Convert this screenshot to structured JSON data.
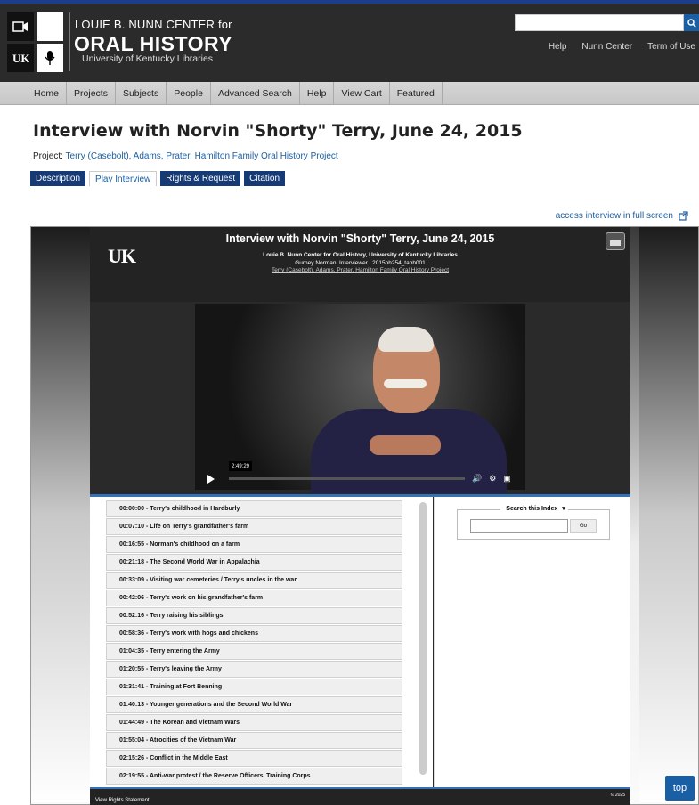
{
  "header": {
    "brand_top": "LOUIE B. NUNN CENTER for",
    "brand_main": "ORAL HISTORY",
    "brand_sub": "University of Kentucky Libraries",
    "search_placeholder": "",
    "links": [
      "Help",
      "Nunn Center",
      "Term of Use"
    ]
  },
  "nav": {
    "items": [
      "Home",
      "Projects",
      "Subjects",
      "People",
      "Advanced Search",
      "Help",
      "View Cart",
      "Featured"
    ]
  },
  "page": {
    "title": "Interview with Norvin \"Shorty\" Terry, June 24, 2015",
    "project_label": "Project:",
    "project_value": "Terry (Casebolt), Adams, Prater, Hamilton Family Oral History Project",
    "tabs": [
      "Description",
      "Play Interview",
      "Rights & Request",
      "Citation"
    ],
    "fullscreen": "access interview in full screen"
  },
  "player": {
    "logo": "UK",
    "title": "Interview with Norvin \"Shorty\" Terry, June 24, 2015",
    "sub1": "Louie B. Nunn Center for Oral History, University of Kentucky Libraries",
    "sub2": "Gurney Norman, Interviewer | 2015oh254_taph001",
    "sub3": "Terry (Casebolt), Adams, Prater, Hamilton Family Oral History Project",
    "time_bubble": "2:49:29"
  },
  "index": {
    "items": [
      "00:00:00 - Terry's childhood in Hardburly",
      "00:07:10 - Life on Terry's grandfather's farm",
      "00:16:55 - Norman's childhood on a farm",
      "00:21:18 - The Second World War in Appalachia",
      "00:33:09 - Visiting war cemeteries / Terry's uncles in the war",
      "00:42:06 - Terry's work on his grandfather's farm",
      "00:52:16 - Terry raising his siblings",
      "00:58:36 - Terry's work with hogs and chickens",
      "01:04:35 - Terry entering the Army",
      "01:20:55 - Terry's leaving the Army",
      "01:31:41 - Training at Fort Benning",
      "01:40:13 - Younger generations and the Second World War",
      "01:44:49 - The Korean and Vietnam Wars",
      "01:55:04 - Atrocities of the Vietnam War",
      "02:15:26 - Conflict in the Middle East",
      "02:19:55 - Anti-war protest / the Reserve Officers' Training Corps"
    ],
    "search_legend": "Search this Index",
    "go_label": "Go"
  },
  "footer": {
    "left": "View Rights Statement",
    "right": "© 2025"
  },
  "top_label": "top",
  "colors": {
    "accent": "#1a5fa3",
    "tab_dark": "#153a76",
    "divider": "#3571b5"
  }
}
